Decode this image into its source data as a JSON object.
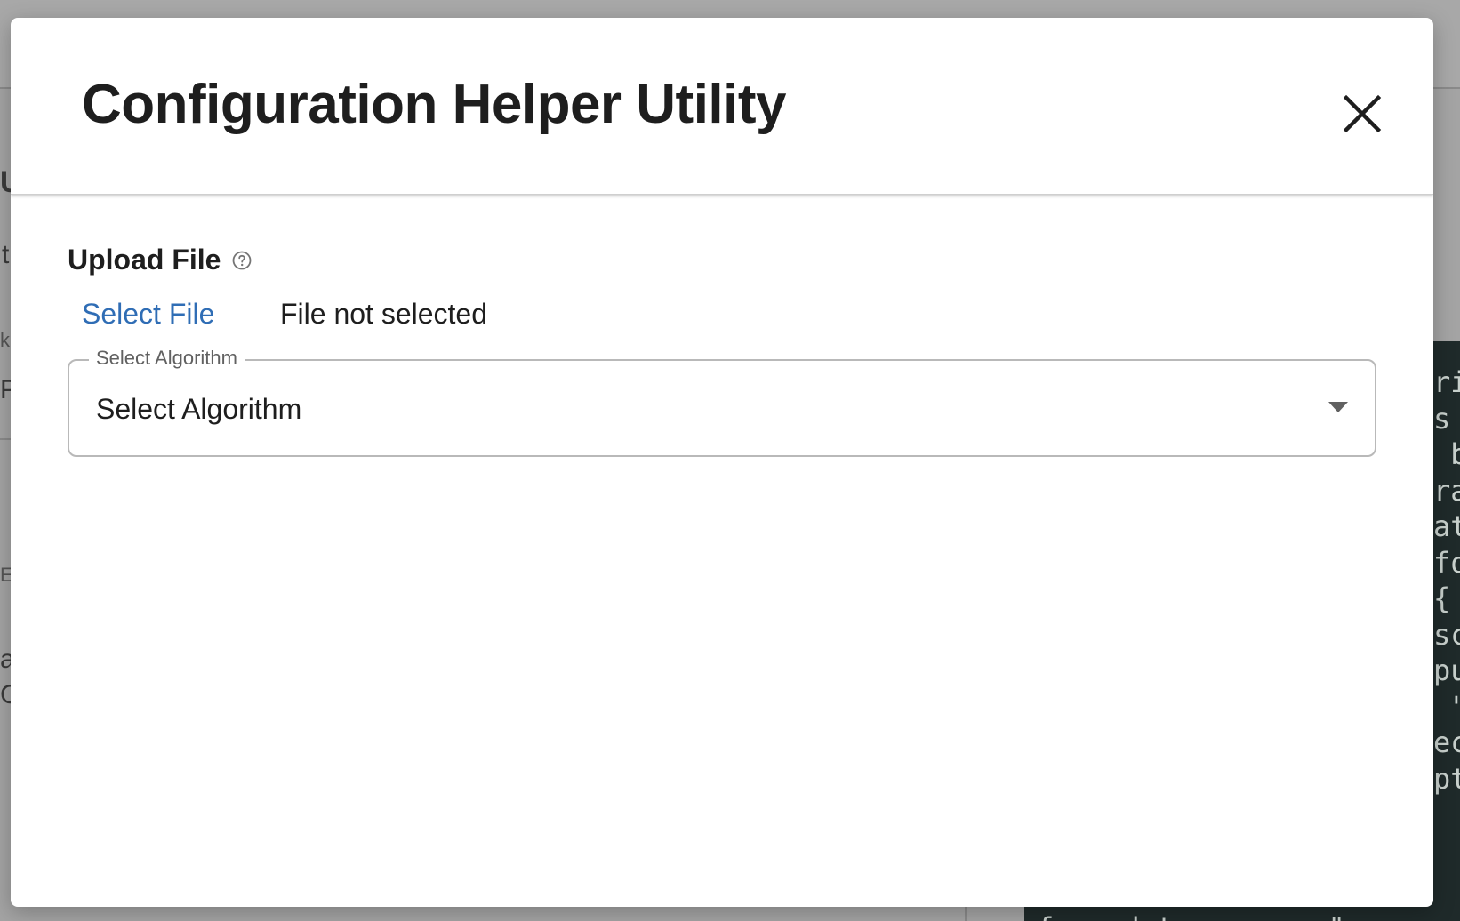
{
  "background": {
    "fragments": [
      "U",
      "t",
      "k",
      "Pl",
      "E",
      "a",
      "C"
    ],
    "code_lines": [
      "ri",
      "s",
      " b",
      "ra",
      "at",
      "fo",
      "",
      "{",
      "sc",
      "",
      "pu",
      " \"",
      "ec",
      "pt"
    ],
    "code_last_line": "from data source.\""
  },
  "modal": {
    "title": "Configuration Helper Utility",
    "close_icon": "close-icon",
    "upload": {
      "label": "Upload File",
      "help_icon": "help-circle-icon",
      "select_label": "Select File",
      "status": "File not selected"
    },
    "algorithm": {
      "legend": "Select Algorithm",
      "value": "Select Algorithm",
      "arrow_icon": "caret-down-icon"
    }
  },
  "colors": {
    "link": "#2f6db5",
    "title": "#1e1e1e",
    "overlay": "#a4a4a4",
    "code_bg": "#1f2a2a"
  }
}
